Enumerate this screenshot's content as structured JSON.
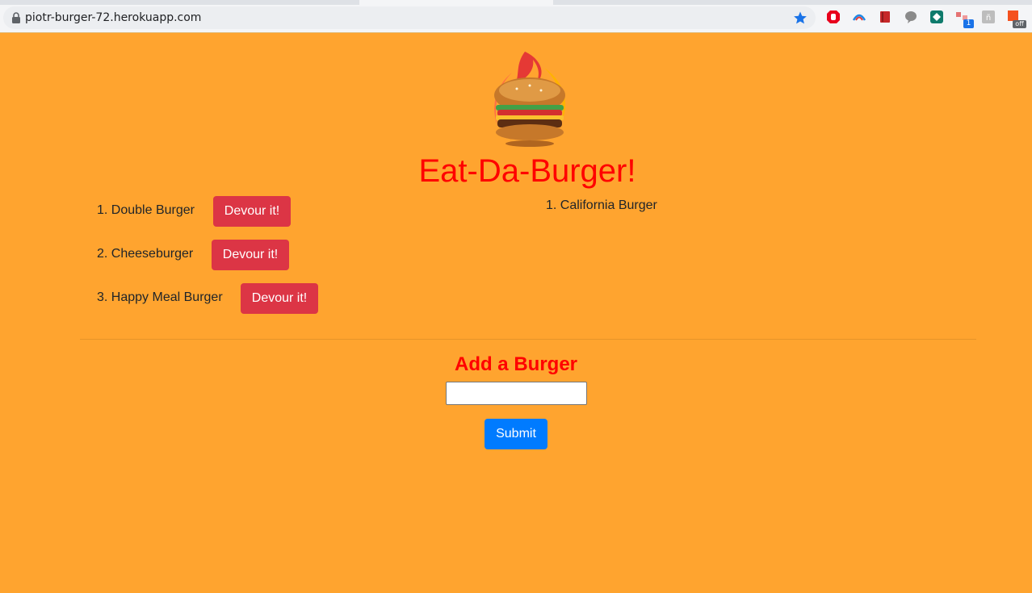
{
  "browser": {
    "url": "piotr-burger-72.herokuapp.com",
    "extensions": [
      "adblock-icon",
      "rainbow-arc-icon",
      "red-book-icon",
      "speech-bubble-icon",
      "feedly-icon",
      "network-icon",
      "glyph-icon",
      "off-badge-icon"
    ],
    "extension_badge": "1",
    "off_badge": "off"
  },
  "header": {
    "title": "Eat-Da-Burger!"
  },
  "uneaten": [
    {
      "number": "1.",
      "name": "Double Burger"
    },
    {
      "number": "2.",
      "name": "Cheeseburger"
    },
    {
      "number": "3.",
      "name": "Happy Meal Burger"
    }
  ],
  "devour_label": "Devour it!",
  "devoured": [
    {
      "number": "1.",
      "name": "California Burger"
    }
  ],
  "form": {
    "title": "Add a Burger",
    "input_value": "",
    "submit_label": "Submit"
  },
  "colors": {
    "background": "#ffa42f",
    "title": "#ff0000",
    "devour_button": "#dc3545",
    "submit_button": "#007bff"
  }
}
